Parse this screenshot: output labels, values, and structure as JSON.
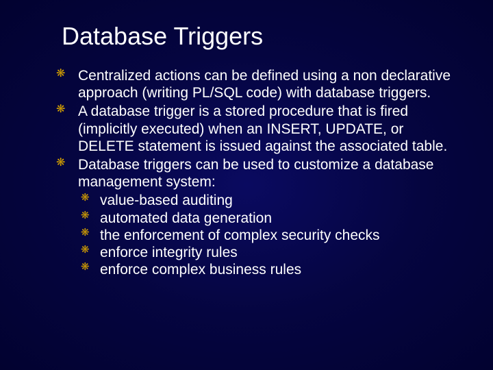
{
  "title": "Database Triggers",
  "bullets": [
    "Centralized actions can be defined using a non declarative approach (writing PL/SQL code) with database triggers.",
    "A database trigger is a stored procedure that is fired (implicitly executed) when an INSERT, UPDATE, or DELETE statement is issued against the associated table.",
    "Database triggers can be used to customize a database management system:"
  ],
  "sub_bullets": [
    "value-based auditing",
    "automated data generation",
    "the enforcement of complex security checks",
    "enforce integrity rules",
    "enforce complex business rules"
  ]
}
